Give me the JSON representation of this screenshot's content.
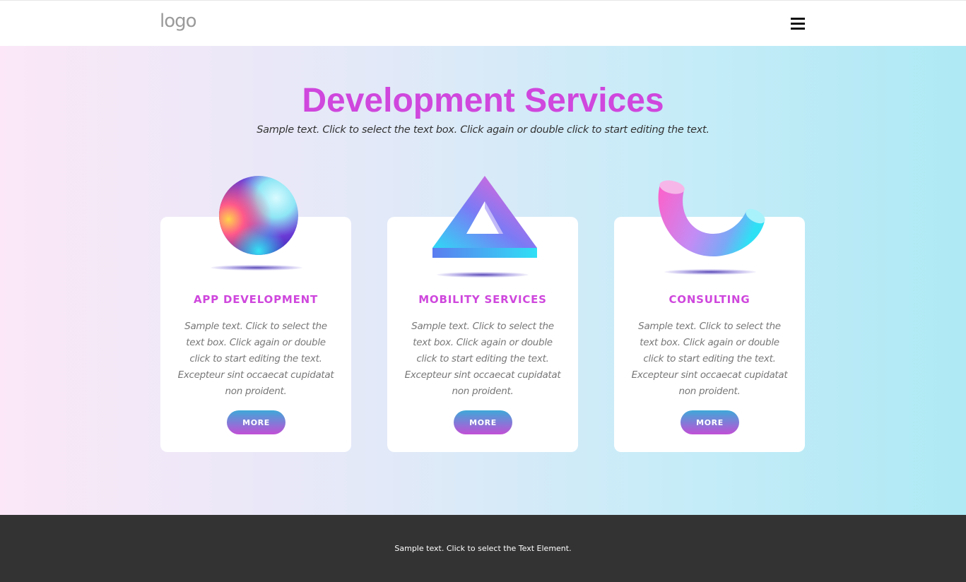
{
  "header": {
    "logo": "logo",
    "menu_icon": "hamburger-menu-icon"
  },
  "hero": {
    "title": "Development Services",
    "subtitle": "Sample text. Click to select the text box. Click again or double click to start editing the text."
  },
  "cards": [
    {
      "title": "APP DEVELOPMENT",
      "text": "Sample text. Click to select the text box. Click again or double click to start editing the text. Excepteur sint occaecat cupidatat non proident.",
      "button": "MORE",
      "icon": "sphere-icon"
    },
    {
      "title": "MOBILITY SERVICES",
      "text": "Sample text. Click to select the text box. Click again or double click to start editing the text. Excepteur sint occaecat cupidatat non proident.",
      "button": "MORE",
      "icon": "triangle-icon"
    },
    {
      "title": "CONSULTING",
      "text": "Sample text. Click to select the text box. Click again or double click to start editing the text. Excepteur sint occaecat cupidatat non proident.",
      "button": "MORE",
      "icon": "torus-arc-icon"
    }
  ],
  "footer": {
    "text": "Sample text. Click to select the Text Element."
  },
  "colors": {
    "accent": "#cf47dd",
    "footer_bg": "#333333",
    "button_top": "#3fa8d8",
    "button_bottom": "#c24fd6"
  }
}
